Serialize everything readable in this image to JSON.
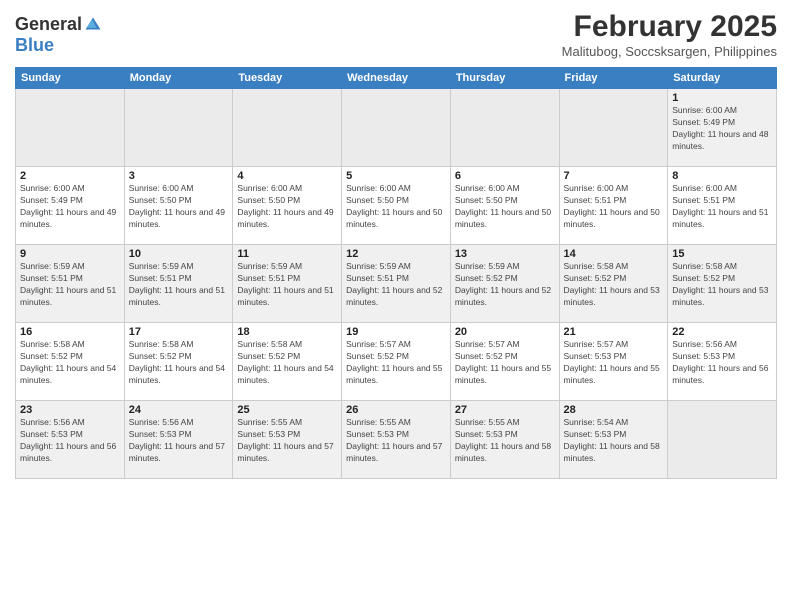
{
  "header": {
    "logo_general": "General",
    "logo_blue": "Blue",
    "month_year": "February 2025",
    "location": "Malitubog, Soccsksargen, Philippines"
  },
  "days_of_week": [
    "Sunday",
    "Monday",
    "Tuesday",
    "Wednesday",
    "Thursday",
    "Friday",
    "Saturday"
  ],
  "weeks": [
    [
      {
        "day": "",
        "empty": true
      },
      {
        "day": "",
        "empty": true
      },
      {
        "day": "",
        "empty": true
      },
      {
        "day": "",
        "empty": true
      },
      {
        "day": "",
        "empty": true
      },
      {
        "day": "",
        "empty": true
      },
      {
        "day": "1",
        "sunrise": "6:00 AM",
        "sunset": "5:49 PM",
        "daylight": "11 hours and 48 minutes."
      }
    ],
    [
      {
        "day": "2",
        "sunrise": "6:00 AM",
        "sunset": "5:49 PM",
        "daylight": "11 hours and 49 minutes."
      },
      {
        "day": "3",
        "sunrise": "6:00 AM",
        "sunset": "5:50 PM",
        "daylight": "11 hours and 49 minutes."
      },
      {
        "day": "4",
        "sunrise": "6:00 AM",
        "sunset": "5:50 PM",
        "daylight": "11 hours and 49 minutes."
      },
      {
        "day": "5",
        "sunrise": "6:00 AM",
        "sunset": "5:50 PM",
        "daylight": "11 hours and 50 minutes."
      },
      {
        "day": "6",
        "sunrise": "6:00 AM",
        "sunset": "5:50 PM",
        "daylight": "11 hours and 50 minutes."
      },
      {
        "day": "7",
        "sunrise": "6:00 AM",
        "sunset": "5:51 PM",
        "daylight": "11 hours and 50 minutes."
      },
      {
        "day": "8",
        "sunrise": "6:00 AM",
        "sunset": "5:51 PM",
        "daylight": "11 hours and 51 minutes."
      }
    ],
    [
      {
        "day": "9",
        "sunrise": "5:59 AM",
        "sunset": "5:51 PM",
        "daylight": "11 hours and 51 minutes."
      },
      {
        "day": "10",
        "sunrise": "5:59 AM",
        "sunset": "5:51 PM",
        "daylight": "11 hours and 51 minutes."
      },
      {
        "day": "11",
        "sunrise": "5:59 AM",
        "sunset": "5:51 PM",
        "daylight": "11 hours and 51 minutes."
      },
      {
        "day": "12",
        "sunrise": "5:59 AM",
        "sunset": "5:51 PM",
        "daylight": "11 hours and 52 minutes."
      },
      {
        "day": "13",
        "sunrise": "5:59 AM",
        "sunset": "5:52 PM",
        "daylight": "11 hours and 52 minutes."
      },
      {
        "day": "14",
        "sunrise": "5:58 AM",
        "sunset": "5:52 PM",
        "daylight": "11 hours and 53 minutes."
      },
      {
        "day": "15",
        "sunrise": "5:58 AM",
        "sunset": "5:52 PM",
        "daylight": "11 hours and 53 minutes."
      }
    ],
    [
      {
        "day": "16",
        "sunrise": "5:58 AM",
        "sunset": "5:52 PM",
        "daylight": "11 hours and 54 minutes."
      },
      {
        "day": "17",
        "sunrise": "5:58 AM",
        "sunset": "5:52 PM",
        "daylight": "11 hours and 54 minutes."
      },
      {
        "day": "18",
        "sunrise": "5:58 AM",
        "sunset": "5:52 PM",
        "daylight": "11 hours and 54 minutes."
      },
      {
        "day": "19",
        "sunrise": "5:57 AM",
        "sunset": "5:52 PM",
        "daylight": "11 hours and 55 minutes."
      },
      {
        "day": "20",
        "sunrise": "5:57 AM",
        "sunset": "5:52 PM",
        "daylight": "11 hours and 55 minutes."
      },
      {
        "day": "21",
        "sunrise": "5:57 AM",
        "sunset": "5:53 PM",
        "daylight": "11 hours and 55 minutes."
      },
      {
        "day": "22",
        "sunrise": "5:56 AM",
        "sunset": "5:53 PM",
        "daylight": "11 hours and 56 minutes."
      }
    ],
    [
      {
        "day": "23",
        "sunrise": "5:56 AM",
        "sunset": "5:53 PM",
        "daylight": "11 hours and 56 minutes."
      },
      {
        "day": "24",
        "sunrise": "5:56 AM",
        "sunset": "5:53 PM",
        "daylight": "11 hours and 57 minutes."
      },
      {
        "day": "25",
        "sunrise": "5:55 AM",
        "sunset": "5:53 PM",
        "daylight": "11 hours and 57 minutes."
      },
      {
        "day": "26",
        "sunrise": "5:55 AM",
        "sunset": "5:53 PM",
        "daylight": "11 hours and 57 minutes."
      },
      {
        "day": "27",
        "sunrise": "5:55 AM",
        "sunset": "5:53 PM",
        "daylight": "11 hours and 58 minutes."
      },
      {
        "day": "28",
        "sunrise": "5:54 AM",
        "sunset": "5:53 PM",
        "daylight": "11 hours and 58 minutes."
      },
      {
        "day": "",
        "empty": true
      }
    ]
  ]
}
